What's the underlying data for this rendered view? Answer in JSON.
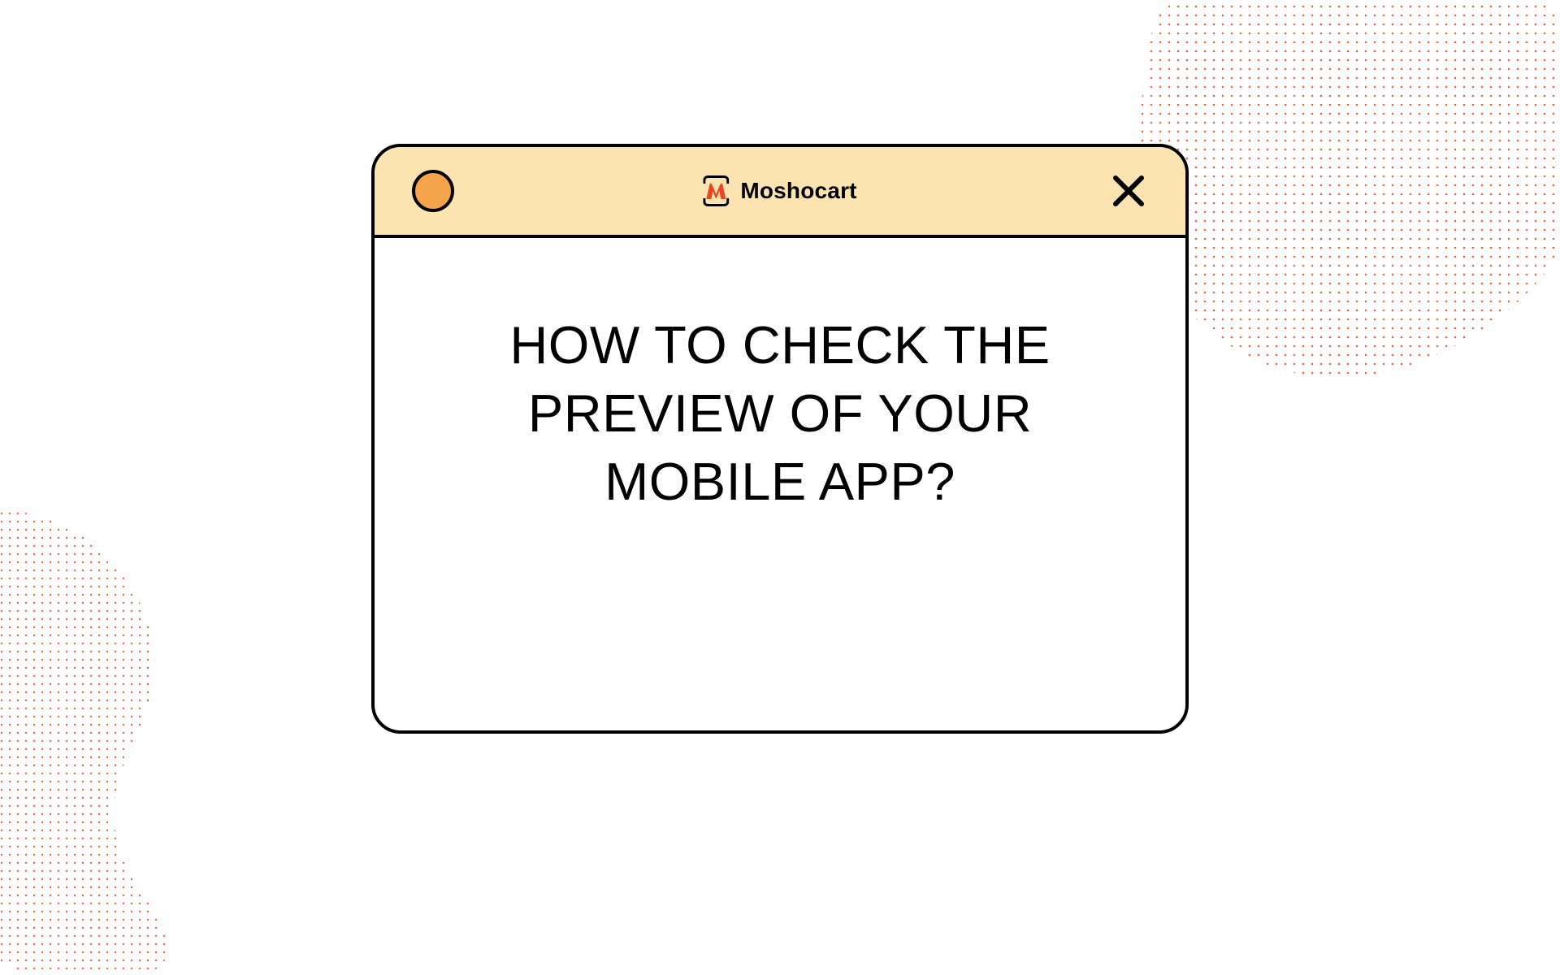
{
  "brand": {
    "name": "Moshocart"
  },
  "icons": {
    "window_dot": "window-dot-icon",
    "close": "close-icon",
    "logo": "moshocart-logo-icon"
  },
  "content": {
    "headline": "HOW TO CHECK THE PREVIEW OF YOUR MOBILE APP?"
  },
  "colors": {
    "titlebar_bg": "#fbe4b1",
    "dot_fill": "#f5a44b",
    "accent": "#e45025",
    "border": "#000000"
  }
}
